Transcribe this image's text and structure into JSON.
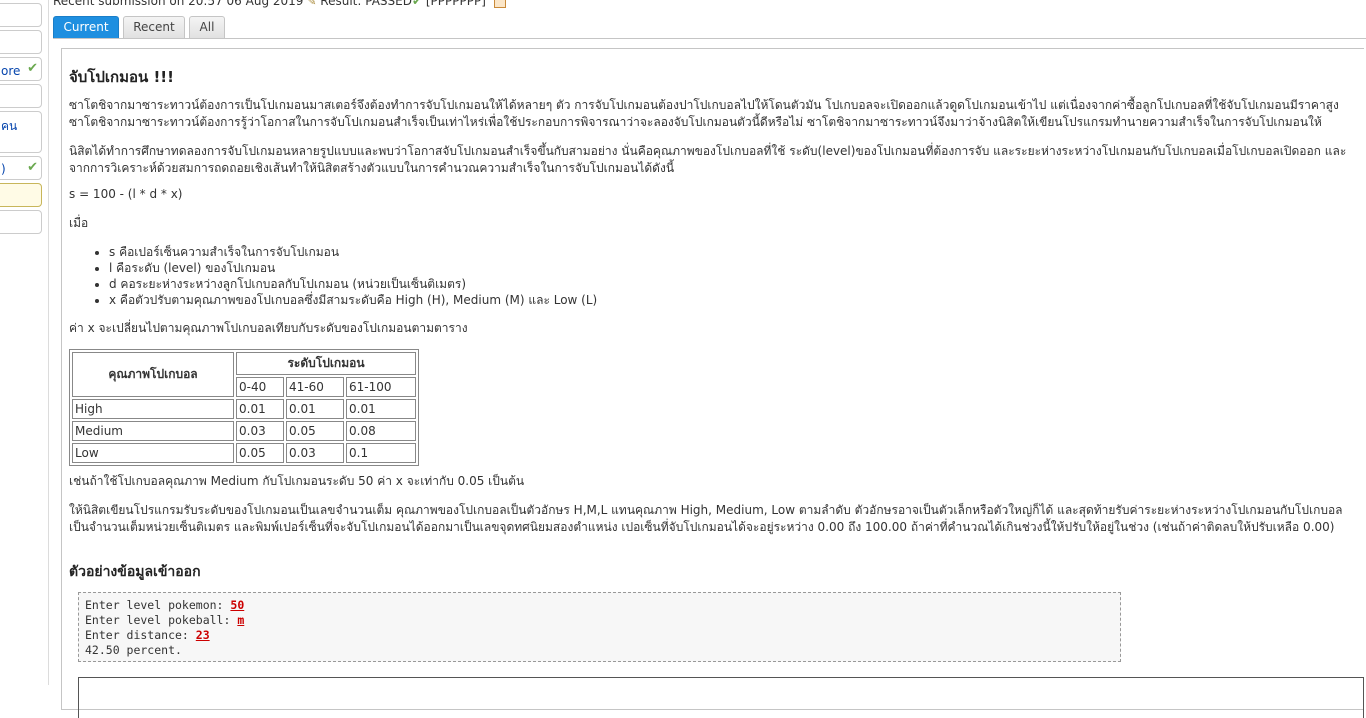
{
  "submission": {
    "text": "Recent submission on 20:57 06 Aug 2019",
    "result": "Result: PASSED",
    "code": "[PPPPPPP]"
  },
  "sidebar": {
    "items": [
      {
        "label": "",
        "checked": false
      },
      {
        "label": "",
        "checked": false
      },
      {
        "label": "ore",
        "checked": true
      },
      {
        "label": "",
        "checked": false
      },
      {
        "label": "คน",
        "checked": false
      },
      {
        "label": ")",
        "checked": true
      },
      {
        "label": "",
        "checked": false
      },
      {
        "label": "",
        "checked": false
      }
    ]
  },
  "tabs": [
    {
      "label": "Current"
    },
    {
      "label": "Recent"
    },
    {
      "label": "All"
    }
  ],
  "problem": {
    "title": "จับโปเกมอน !!!",
    "p1": "ซาโตชิจากมาซาระทาวน์ต้องการเป็นโปเกมอนมาสเตอร์จึงต้องทำการจับโปเกมอนให้ได้หลายๆ ตัว การจับโปเกมอนต้องปาโปเกบอลไปให้โดนตัวมัน โปเกบอลจะเปิดออกแล้วดูดโปเกมอนเข้าไป แต่เนื่องจากค่าซื้อลูกโปเกบอลที่ใช้จับโปเกมอนมีราคาสูง ซาโตชิจากมาซาระทาวน์ต้องการรู้ว่าโอกาสในการจับโปเกมอนสำเร็จเป็นเท่าไหร่เพื่อใช้ประกอบการพิจารณาว่าจะลองจับโปเกมอนตัวนี้ดีหรือไม่ ซาโตชิจากมาซาระทาวน์จึงมาว่าจ้างนิสิตให้เขียนโปรแกรมทำนายความสำเร็จในการจับโปเกมอนให้",
    "p2": "นิสิตได้ทำการศึกษาทดลองการจับโปเกมอนหลายรูปแบบและพบว่าโอกาสจับโปเกมอนสำเร็จขึ้นกับสามอย่าง นั่นคือคุณภาพของโปเกบอลที่ใช้ ระดับ(level)ของโปเกมอนที่ต้องการจับ และระยะห่างระหว่างโปเกมอนกับโปเกบอลเมื่อโปเกบอลเปิดออก และจากการวิเคราะห์ด้วยสมการถดถอยเชิงเส้นทำให้นิสิตสร้างตัวแบบในการคำนวณความสำเร็จในการจับโปเกมอนได้ดังนี้",
    "formula": "s = 100 - (l * d * x)",
    "when": "เมื่อ",
    "bullets": [
      "s คือเปอร์เซ็นความสำเร็จในการจับโปเกมอน",
      "l คือระดับ (level) ของโปเกมอน",
      "d คอระยะห่างระหว่างลูกโปเกบอลกับโปเกมอน (หน่วยเป็นเซ็นติเมตร)",
      "x คือตัวปรับตามคุณภาพของโปเกบอลซึ่งมีสามระดับคือ High (H), Medium (M) และ Low (L)"
    ],
    "p3": "ค่า x จะเปลี่ยนไปตามคุณภาพโปเกบอลเทียบกับระดับของโปเกมอนตามตาราง",
    "table": {
      "quality_header": "คุณภาพโปเกบอล",
      "level_header": "ระดับโปเกมอน",
      "levels": [
        "0-40",
        "41-60",
        "61-100"
      ],
      "rows": [
        {
          "name": "High",
          "values": [
            "0.01",
            "0.01",
            "0.01"
          ]
        },
        {
          "name": "Medium",
          "values": [
            "0.03",
            "0.05",
            "0.08"
          ]
        },
        {
          "name": "Low",
          "values": [
            "0.05",
            "0.03",
            "0.1"
          ]
        }
      ]
    },
    "p4": "เช่นถ้าใช้โปเกบอลคุณภาพ Medium กับโปเกมอนระดับ 50 ค่า x จะเท่ากับ 0.05 เป็นต้น",
    "p5": "ให้นิสิตเขียนโปรแกรมรับระดับของโปเกมอนเป็นเลขจำนวนเต็ม คุณภาพของโปเกบอลเป็นตัวอักษร H,M,L แทนคุณภาพ High, Medium, Low ตามลำดับ ตัวอักษรอาจเป็นตัวเล็กหรือตัวใหญ่ก็ได้ และสุดท้ายรับค่าระยะห่างระหว่างโปเกมอนกับโปเกบอลเป็นจำนวนเต็มหน่วยเซ็นติเมตร และพิมพ์เปอร์เซ็นที่จะจับโปเกมอนได้ออกมาเป็นเลขจุดทศนิยมสองตำแหน่ง เปอเซ็นที่จับโปเกมอนได้จะอยู่ระหว่าง 0.00 ถึง 100.00 ถ้าค่าที่คำนวณได้เกินช่วงนี้ให้ปรับให้อยู่ในช่วง (เช่นถ้าค่าติดลบให้ปรับเหลือ 0.00)",
    "sample_heading": "ตัวอย่างข้อมูลเข้าออก",
    "sample": {
      "l1_prompt": "Enter level pokemon: ",
      "l1_input": "50",
      "l2_prompt": "Enter level pokeball: ",
      "l2_input": "m",
      "l3_prompt": "Enter distance: ",
      "l3_input": "23",
      "l4": "42.50 percent."
    }
  }
}
